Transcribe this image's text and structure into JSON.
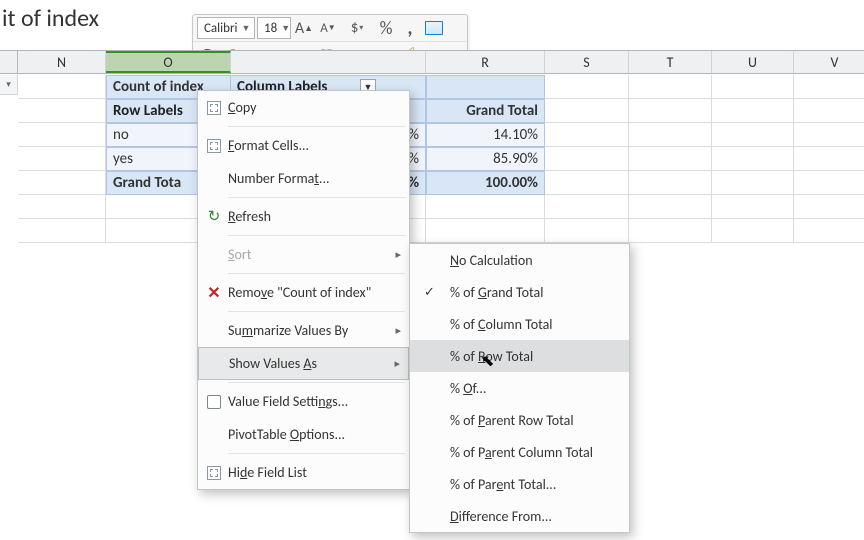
{
  "title_fragment": "it of index",
  "toolbar": {
    "font_name": "Calibri",
    "font_size": "18",
    "currency": "$",
    "percent": "%",
    "comma": ","
  },
  "columns": [
    "N",
    "O",
    "R",
    "S",
    "T",
    "U",
    "V"
  ],
  "column_widths": {
    "N": 88,
    "O": 125,
    "gap": 195,
    "R": 119,
    "S": 84,
    "T": 83,
    "U": 82,
    "V": 82
  },
  "pivot": {
    "corner_label": "Count of index",
    "col_label": "Column Labels",
    "row_label_header": "Row Labels",
    "grand_total_label": "Grand Total",
    "rows": [
      {
        "label": "no",
        "pct_visible": "%",
        "grand": "14.10%"
      },
      {
        "label": "yes",
        "pct_visible": "%",
        "grand": "85.90%"
      }
    ],
    "total_row": {
      "label": "Grand Tota",
      "pct_visible": "%",
      "grand": "100.00%"
    }
  },
  "context_menu": [
    {
      "kind": "item",
      "label_pre": "",
      "mnem": "C",
      "label_post": "opy",
      "icon": "copy"
    },
    {
      "kind": "sep"
    },
    {
      "kind": "item",
      "label_pre": "",
      "mnem": "F",
      "label_post": "ormat Cells...",
      "icon": "formatcells"
    },
    {
      "kind": "item",
      "label_pre": "Number Forma",
      "mnem": "t",
      "label_post": "...",
      "icon": ""
    },
    {
      "kind": "sep"
    },
    {
      "kind": "item",
      "label_pre": "",
      "mnem": "R",
      "label_post": "efresh",
      "icon": "refresh"
    },
    {
      "kind": "sep"
    },
    {
      "kind": "item",
      "label_pre": "",
      "mnem": "S",
      "label_post": "ort",
      "icon": "",
      "sub": true,
      "disabled": true
    },
    {
      "kind": "sep"
    },
    {
      "kind": "item",
      "label_pre": "Remo",
      "mnem": "v",
      "label_post": "e \"Count of index\"",
      "icon": "remove"
    },
    {
      "kind": "sep"
    },
    {
      "kind": "item",
      "label_pre": "Su",
      "mnem": "m",
      "label_post": "marize Values By",
      "icon": "",
      "sub": true
    },
    {
      "kind": "item",
      "label_pre": "Show Values ",
      "mnem": "A",
      "label_post": "s",
      "icon": "",
      "sub": true,
      "highlighted": true
    },
    {
      "kind": "sep"
    },
    {
      "kind": "item",
      "label_pre": "Value Field Setti",
      "mnem": "n",
      "label_post": "gs...",
      "icon": "gear"
    },
    {
      "kind": "item",
      "label_pre": "PivotTable ",
      "mnem": "O",
      "label_post": "ptions...",
      "icon": ""
    },
    {
      "kind": "sep"
    },
    {
      "kind": "item",
      "label_pre": "Hi",
      "mnem": "d",
      "label_post": "e Field List",
      "icon": "fieldlist"
    }
  ],
  "submenu": [
    {
      "label_pre": "",
      "mnem": "N",
      "label_post": "o Calculation"
    },
    {
      "label_pre": "% of ",
      "mnem": "G",
      "label_post": "rand Total",
      "checked": true
    },
    {
      "label_pre": "% of ",
      "mnem": "C",
      "label_post": "olumn Total"
    },
    {
      "label_pre": "% of ",
      "mnem": "R",
      "label_post": "ow Total",
      "highlighted": true
    },
    {
      "label_pre": "% ",
      "mnem": "O",
      "label_post": "f..."
    },
    {
      "label_pre": "% of ",
      "mnem": "P",
      "label_post": "arent Row Total"
    },
    {
      "label_pre": "% of P",
      "mnem": "a",
      "label_post": "rent Column Total"
    },
    {
      "label_pre": "% of Par",
      "mnem": "e",
      "label_post": "nt Total..."
    },
    {
      "label_pre": "",
      "mnem": "D",
      "label_post": "ifference From..."
    }
  ]
}
